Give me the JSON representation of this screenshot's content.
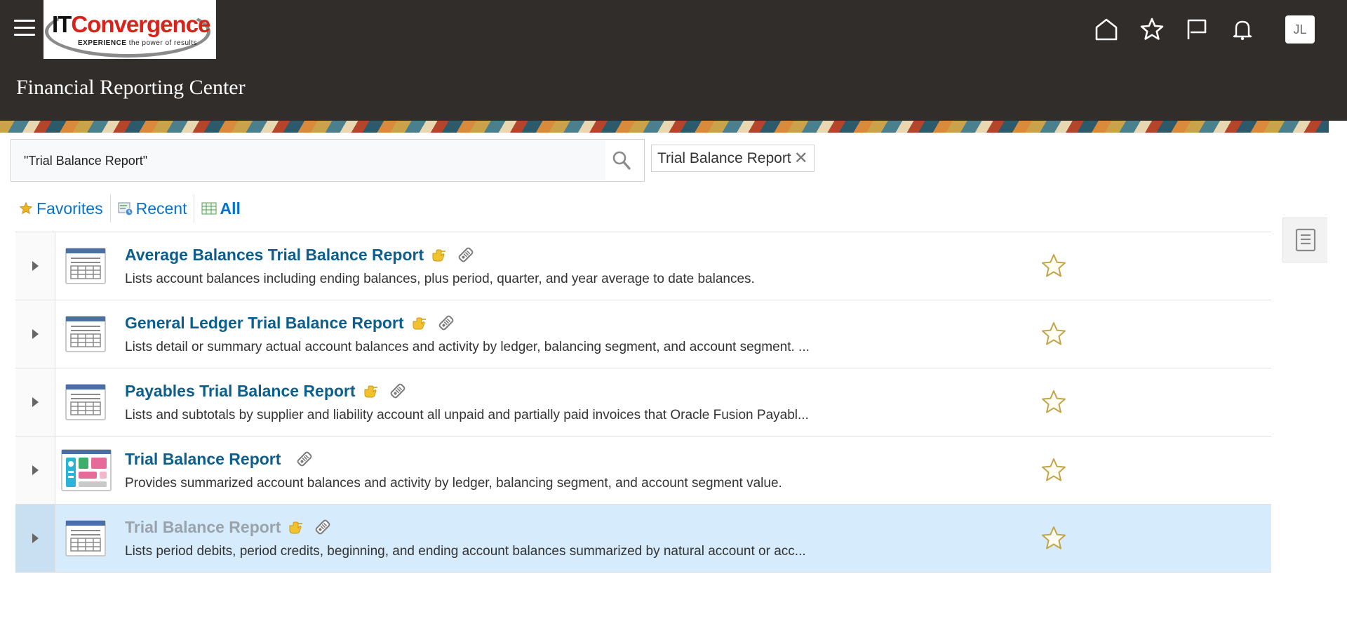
{
  "header": {
    "logo": {
      "brand_it": "IT",
      "brand_rest": "Convergence",
      "tagline_bold": "EXPERIENCE",
      "tagline_rest": " the power of results"
    },
    "page_title": "Financial Reporting Center",
    "icons": [
      "home-icon",
      "star-icon",
      "flag-icon",
      "bell-icon"
    ],
    "avatar_initials": "JL"
  },
  "search": {
    "value": "\"Trial Balance Report\"",
    "chip_label": "Trial Balance Report",
    "chip_close": "✕"
  },
  "tabs": [
    {
      "label": "Favorites",
      "icon": "star-icon",
      "active": false
    },
    {
      "label": "Recent",
      "icon": "recent-icon",
      "active": false
    },
    {
      "label": "All",
      "icon": "grid-icon",
      "active": true
    }
  ],
  "results": [
    {
      "title": "Average Balances Trial Balance Report",
      "description": "Lists account balances including ending balances, plus period, quarter, and year average to date balances.",
      "icon": "report-table-icon",
      "has_hand": true,
      "selected": false
    },
    {
      "title": "General Ledger Trial Balance Report",
      "description": "Lists detail or summary actual account balances and activity by ledger, balancing segment, and account segment. ...",
      "icon": "report-table-icon",
      "has_hand": true,
      "selected": false
    },
    {
      "title": "Payables Trial Balance Report",
      "description": "Lists and subtotals by supplier and liability account all unpaid and partially paid invoices that Oracle Fusion Payabl...",
      "icon": "report-table-icon",
      "has_hand": true,
      "selected": false
    },
    {
      "title": "Trial Balance Report",
      "description": "Provides summarized account balances and activity by ledger, balancing segment, and account segment value.",
      "icon": "dashboard-report-icon",
      "has_hand": false,
      "selected": false
    },
    {
      "title": "Trial Balance Report",
      "description": "Lists period debits, period credits, beginning, and ending account balances summarized by natural account or acc...",
      "icon": "report-table-icon",
      "has_hand": true,
      "selected": true
    }
  ],
  "colors": {
    "header_bg": "#312d2a",
    "link": "#0c5e8d",
    "tab_link": "#0572ce",
    "selected_row": "#d6ebfb"
  }
}
